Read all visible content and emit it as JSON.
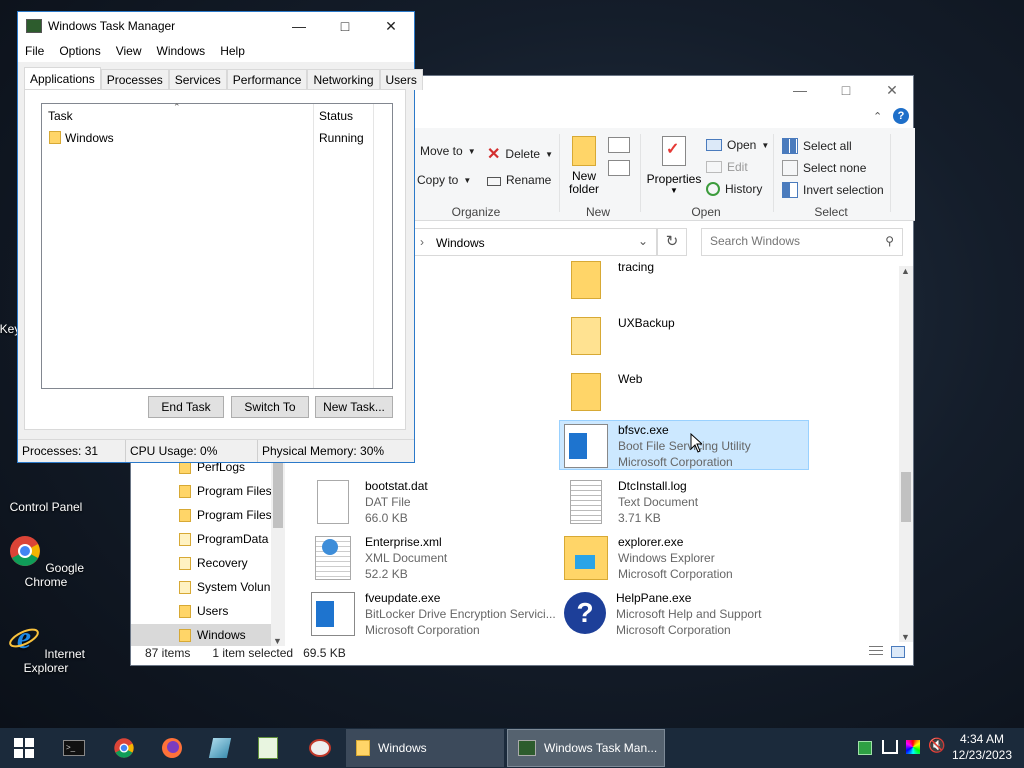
{
  "desktop": {
    "icons": [
      {
        "label": "Control Panel"
      },
      {
        "label": "Google Chrome"
      },
      {
        "label": "Internet Explorer"
      }
    ],
    "partial_label": "Key"
  },
  "explorer": {
    "ribbon": {
      "move_to": "Move to",
      "copy_to": "Copy to",
      "delete": "Delete",
      "rename": "Rename",
      "new_folder_line1": "New",
      "new_folder_line2": "folder",
      "properties": "Properties",
      "open": "Open",
      "edit": "Edit",
      "history": "History",
      "select_all": "Select all",
      "select_none": "Select none",
      "invert_selection": "Invert selection",
      "groups": {
        "organize": "Organize",
        "new": "New",
        "open": "Open",
        "select": "Select"
      }
    },
    "address": {
      "path": "Windows"
    },
    "search": {
      "placeholder": "Search Windows"
    },
    "nav_items": [
      {
        "label": "PerfLogs"
      },
      {
        "label": "Program Files"
      },
      {
        "label": "Program Files"
      },
      {
        "label": "ProgramData"
      },
      {
        "label": "Recovery"
      },
      {
        "label": "System Volun"
      },
      {
        "label": "Users"
      },
      {
        "label": "Windows"
      }
    ],
    "folders": [
      {
        "name": "tracing"
      },
      {
        "name": "UXBackup"
      },
      {
        "name": "Web"
      }
    ],
    "files": [
      {
        "name": "bfsvc.exe",
        "line1": "Boot File Servicing Utility",
        "line2": "Microsoft Corporation"
      },
      {
        "name": "bootstat.dat",
        "line1": "DAT File",
        "line2": "66.0 KB"
      },
      {
        "name": "DtcInstall.log",
        "line1": "Text Document",
        "line2": "3.71 KB"
      },
      {
        "name": "Enterprise.xml",
        "line1": "XML Document",
        "line2": "52.2 KB"
      },
      {
        "name": "explorer.exe",
        "line1": "Windows Explorer",
        "line2": "Microsoft Corporation"
      },
      {
        "name": "fveupdate.exe",
        "line1": "BitLocker Drive Encryption Servici...",
        "line2": "Microsoft Corporation"
      },
      {
        "name": "HelpPane.exe",
        "line1": "Microsoft Help and Support",
        "line2": "Microsoft Corporation"
      }
    ],
    "status": {
      "items": "87 items",
      "selected": "1 item selected",
      "size": "69.5 KB"
    }
  },
  "taskmgr": {
    "title": "Windows Task Manager",
    "menu": [
      "File",
      "Options",
      "View",
      "Windows",
      "Help"
    ],
    "tabs": [
      "Applications",
      "Processes",
      "Services",
      "Performance",
      "Networking",
      "Users"
    ],
    "columns": {
      "task": "Task",
      "status": "Status"
    },
    "rows": [
      {
        "task": "Windows",
        "status": "Running"
      }
    ],
    "buttons": {
      "end_task": "End Task",
      "switch_to": "Switch To",
      "new_task": "New Task..."
    },
    "status": {
      "processes": "Processes: 31",
      "cpu": "CPU Usage: 0%",
      "memory": "Physical Memory: 30%"
    }
  },
  "taskbar": {
    "tasks": [
      {
        "label": "Windows"
      },
      {
        "label": "Windows Task Man..."
      }
    ],
    "clock": {
      "time": "4:34 AM",
      "date": "12/23/2023"
    }
  }
}
